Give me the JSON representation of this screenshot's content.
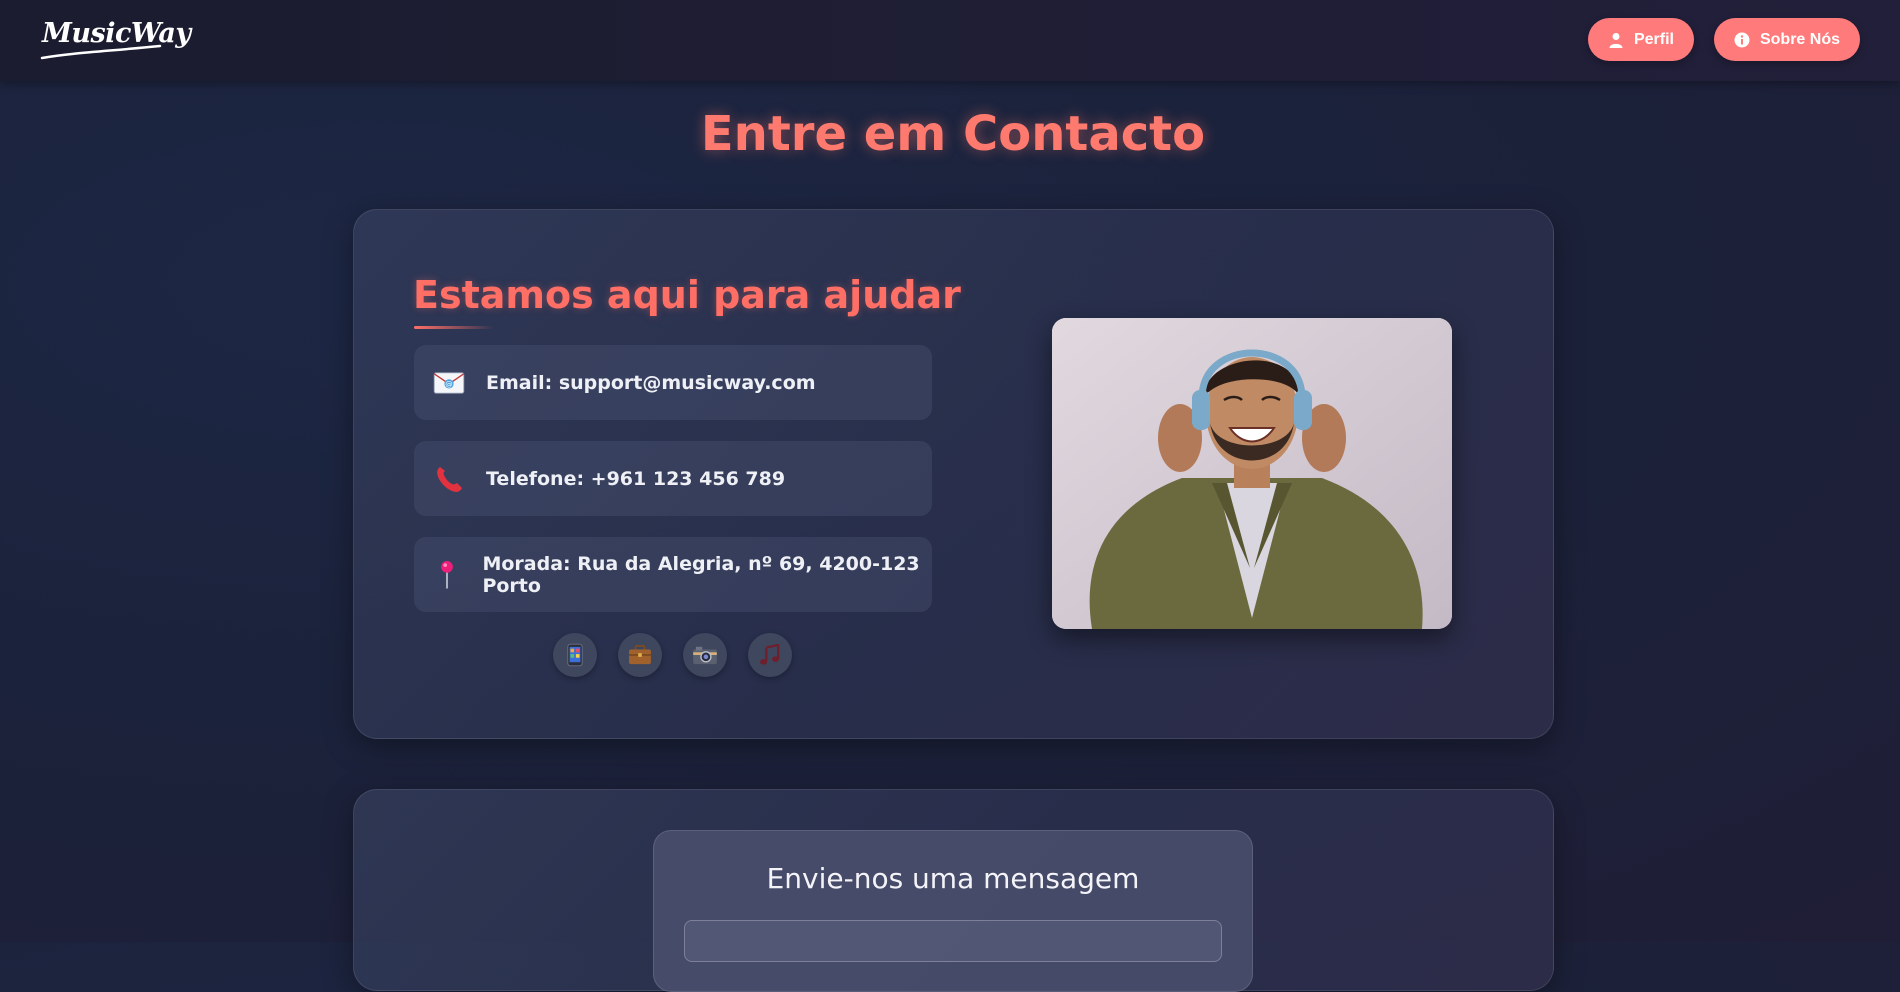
{
  "navbar": {
    "logo_text": "MusicWay",
    "buttons": [
      {
        "label": "Perfil",
        "icon": "user-icon"
      },
      {
        "label": "Sobre Nós",
        "icon": "info-icon"
      }
    ]
  },
  "page": {
    "title": "Entre em Contacto"
  },
  "contact": {
    "heading": "Estamos aqui para ajudar",
    "items": [
      {
        "icon": "envelope-icon",
        "text": "Email: support@musicway.com"
      },
      {
        "icon": "telephone-icon",
        "text": "Telefone: +961 123 456 789"
      },
      {
        "icon": "pin-icon",
        "text": "Morada: Rua da Alegria, nº 69, 4200-123 Porto"
      }
    ],
    "social_icons": [
      "mobile-phone-icon",
      "briefcase-icon",
      "camera-icon",
      "music-note-icon"
    ]
  },
  "form": {
    "title": "Envie-nos uma mensagem"
  },
  "colors": {
    "accent": "#ff7b7b",
    "heading": "#ff6f66",
    "background": "#1b223b"
  }
}
